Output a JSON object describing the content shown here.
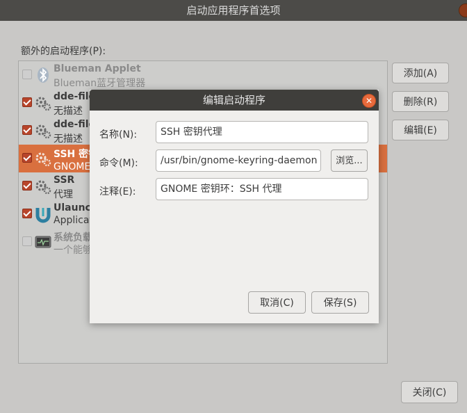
{
  "window": {
    "title": "启动应用程序首选项"
  },
  "list": {
    "label": "额外的启动程序(P):",
    "items": [
      {
        "title": "Blueman Applet",
        "subtitle": "Blueman蓝牙管理器",
        "checked": false,
        "icon": "bluetooth-icon",
        "state": "dim"
      },
      {
        "title": "dde-file-manager",
        "subtitle": "无描述",
        "checked": true,
        "icon": "gears-icon",
        "state": "normal"
      },
      {
        "title": "dde-file-manager",
        "subtitle": "无描述",
        "checked": true,
        "icon": "gears-icon",
        "state": "normal"
      },
      {
        "title": "SSH 密钥代理",
        "subtitle": "GNOME 密钥环：SSH 代理",
        "checked": true,
        "icon": "gears-icon",
        "state": "selected"
      },
      {
        "title": "SSR",
        "subtitle": "代理",
        "checked": true,
        "icon": "gears-icon",
        "state": "normal"
      },
      {
        "title": "Ulauncher",
        "subtitle": "Application launcher",
        "checked": true,
        "icon": "ulauncher-icon",
        "state": "normal"
      },
      {
        "title": "系统负载指示器",
        "subtitle": "一个能够显示系统负载的指示器",
        "checked": false,
        "icon": "system-monitor-icon",
        "state": "dim"
      }
    ]
  },
  "side_buttons": {
    "add": "添加(A)",
    "remove": "删除(R)",
    "edit": "编辑(E)"
  },
  "close_button": "关闭(C)",
  "dialog": {
    "title": "编辑启动程序",
    "name_label": "名称(N):",
    "name_value": "SSH 密钥代理",
    "command_label": "命令(M):",
    "command_value": "/usr/bin/gnome-keyring-daemon --start --components=ssh",
    "browse_label": "浏览...",
    "comment_label": "注释(E):",
    "comment_value": "GNOME 密钥环：SSH 代理",
    "cancel_label": "取消(C)",
    "save_label": "保存(S)"
  }
}
